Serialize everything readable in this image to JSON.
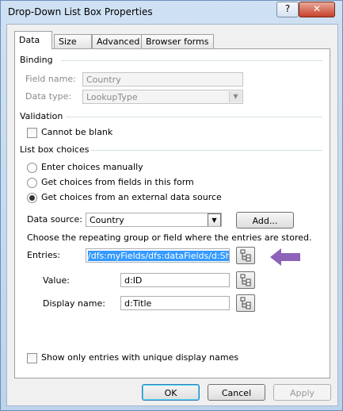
{
  "window": {
    "title": "Drop-Down List Box Properties",
    "help_glyph": "?",
    "close_glyph": "✕"
  },
  "tabs": [
    {
      "label": "Data"
    },
    {
      "label": "Size"
    },
    {
      "label": "Advanced"
    },
    {
      "label": "Browser forms"
    }
  ],
  "binding": {
    "heading": "Binding",
    "field_name_label": "Field name:",
    "field_name_value": "Country",
    "data_type_label": "Data type:",
    "data_type_value": "LookupType"
  },
  "validation": {
    "heading": "Validation",
    "cannot_be_blank_label": "Cannot be blank",
    "cannot_be_blank_checked": false
  },
  "list_box_choices": {
    "heading": "List box choices",
    "options": [
      {
        "label": "Enter choices manually",
        "selected": false
      },
      {
        "label": "Get choices from fields in this form",
        "selected": false
      },
      {
        "label": "Get choices from an external data source",
        "selected": true
      }
    ],
    "data_source_label": "Data source:",
    "data_source_value": "Country",
    "add_button": "Add...",
    "instruction": "Choose the repeating group or field where the entries are stored.",
    "entries_label": "Entries:",
    "entries_value": "/dfs:myFields/dfs:dataFields/d:Sha",
    "value_label": "Value:",
    "value_value": "d:ID",
    "display_name_label": "Display name:",
    "display_name_value": "d:Title",
    "unique_label": "Show only entries with unique display names",
    "unique_checked": false
  },
  "annotation": {
    "arrow_color": "#8e62b8"
  },
  "footer": {
    "ok": "OK",
    "cancel": "Cancel",
    "apply": "Apply"
  },
  "colors": {
    "accent": "#3399ff",
    "frame": "#bcd3ec"
  }
}
